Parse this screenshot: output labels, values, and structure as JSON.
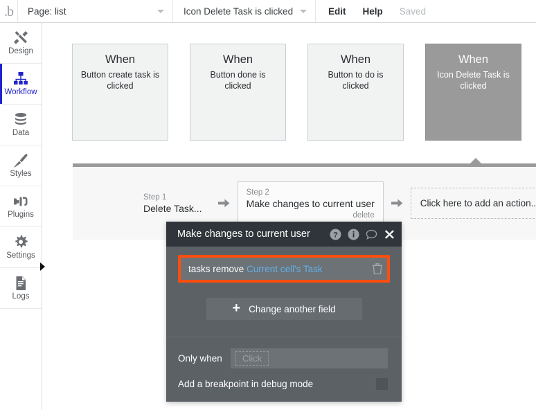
{
  "topbar": {
    "logo": "bubble-logo-icon",
    "page_selector": {
      "label": "Page: list",
      "icon": "chevron-down-icon"
    },
    "event_selector": {
      "label": "Icon Delete Task is clicked",
      "icon": "chevron-down-icon"
    },
    "actions": [
      {
        "label": "Edit",
        "muted": false
      },
      {
        "label": "Help",
        "muted": false
      },
      {
        "label": "Saved",
        "muted": true
      }
    ]
  },
  "sidebar": {
    "items": [
      {
        "label": "Design",
        "icon": "design-tools-icon",
        "active": false
      },
      {
        "label": "Workflow",
        "icon": "workflow-hierarchy-icon",
        "active": true
      },
      {
        "label": "Data",
        "icon": "database-icon",
        "active": false
      },
      {
        "label": "Styles",
        "icon": "paintbrush-icon",
        "active": false
      },
      {
        "label": "Plugins",
        "icon": "plug-icon",
        "active": false
      },
      {
        "label": "Settings",
        "icon": "gear-icon",
        "active": false
      },
      {
        "label": "Logs",
        "icon": "document-lines-icon",
        "active": false
      }
    ],
    "collapse_icon": "collapse-arrow-icon"
  },
  "canvas": {
    "events": [
      {
        "when": "When",
        "description": "Button create task is clicked",
        "selected": false
      },
      {
        "when": "When",
        "description": "Button done is clicked",
        "selected": false
      },
      {
        "when": "When",
        "description": "Button to do is clicked",
        "selected": false
      },
      {
        "when": "When",
        "description": "Icon Delete Task is clicked",
        "selected": true
      }
    ],
    "steps": [
      {
        "num": "Step 1",
        "title": "Delete Task...",
        "sub": "",
        "boxed": false
      },
      {
        "num": "Step 2",
        "title": "Make changes to current user",
        "sub": "delete",
        "boxed": true
      }
    ],
    "add_action_label": "Click here to add an action...",
    "arrow_icon": "arrow-right-icon"
  },
  "panel": {
    "title": "Make changes to current user",
    "icons": [
      {
        "name": "help-question-icon"
      },
      {
        "name": "info-icon"
      },
      {
        "name": "comment-bubble-icon"
      },
      {
        "name": "close-icon"
      }
    ],
    "field": {
      "name": "tasks remove",
      "value": "Current cell's Task",
      "delete_icon": "trash-icon",
      "highlight_color": "#ff4d0d"
    },
    "change_field_button": {
      "label": "Change another field",
      "icon": "plus-icon"
    },
    "only_when": {
      "label": "Only when",
      "placeholder": "Click"
    },
    "breakpoint": {
      "label": "Add a breakpoint in debug mode",
      "checked": false
    }
  }
}
